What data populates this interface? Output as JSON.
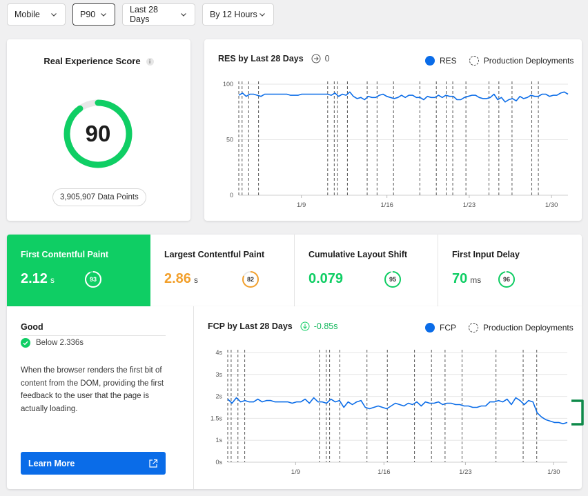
{
  "filters": [
    {
      "label": "Mobile"
    },
    {
      "label": "P90"
    },
    {
      "label": "Last 28 Days"
    },
    {
      "label": "By 12 Hours"
    }
  ],
  "score_card": {
    "title": "Real Experience Score",
    "info_icon": "i",
    "score": "90",
    "score_fraction": 0.9,
    "data_points": "3,905,907 Data Points",
    "colors": {
      "good": "#0fce64",
      "track": "#e8e8e8"
    }
  },
  "res_chart": {
    "title": "RES by Last 28 Days",
    "delta": "0",
    "legend_series": "RES",
    "legend_deploy": "Production Deployments"
  },
  "metrics": [
    {
      "name": "First Contentful Paint",
      "value": "2.12",
      "unit": "s",
      "score": "93",
      "score_fraction": 0.93,
      "color": "#ffffff",
      "selected": true
    },
    {
      "name": "Largest Contentful Paint",
      "value": "2.86",
      "unit": "s",
      "score": "82",
      "score_fraction": 0.82,
      "color": "#f2a02c",
      "selected": false
    },
    {
      "name": "Cumulative Layout Shift",
      "value": "0.079",
      "unit": "",
      "score": "95",
      "score_fraction": 0.95,
      "color": "#0fce64",
      "selected": false
    },
    {
      "name": "First Input Delay",
      "value": "70",
      "unit": "ms",
      "score": "96",
      "score_fraction": 0.96,
      "color": "#0fce64",
      "selected": false
    }
  ],
  "detail": {
    "rating": "Good",
    "threshold": "Below 2.336s",
    "description": "When the browser renders the first bit of content from the DOM, providing the first feedback to the user that the page is actually loading.",
    "learn_more": "Learn More"
  },
  "fcp_chart": {
    "title": "FCP by Last 28 Days",
    "delta": "-0.85s",
    "legend_series": "FCP",
    "legend_deploy": "Production Deployments"
  },
  "chart_data": [
    {
      "type": "line",
      "title": "RES by Last 28 Days",
      "x_tick_labels": [
        "1/9",
        "1/16",
        "1/23",
        "1/30"
      ],
      "y_tick_labels": [
        "0",
        "50",
        "100"
      ],
      "ylim": [
        0,
        100
      ],
      "grid": true,
      "legend": "top-right",
      "series": [
        {
          "name": "RES",
          "color": "#0a6ce8",
          "values": [
            90,
            92,
            89,
            91,
            91,
            90,
            89,
            91,
            91,
            91,
            91,
            91,
            91,
            91,
            90,
            90,
            90,
            91,
            91,
            91,
            91,
            91,
            91,
            91,
            91,
            90,
            92,
            89,
            91,
            90,
            93,
            89,
            87,
            88,
            86,
            89,
            88,
            88,
            90,
            91,
            89,
            88,
            87,
            88,
            90,
            88,
            90,
            90,
            88,
            88,
            86,
            89,
            88,
            88,
            90,
            88,
            90,
            89,
            89,
            86,
            86,
            88,
            89,
            90,
            90,
            88,
            87,
            87,
            88,
            91,
            86,
            88,
            84,
            86,
            87,
            85,
            89,
            87,
            88,
            90,
            89,
            89,
            91,
            91,
            89,
            90,
            90,
            92,
            93,
            91
          ]
        }
      ],
      "deployments_x_fraction": [
        0.0,
        0.01,
        0.03,
        0.06,
        0.27,
        0.29,
        0.3,
        0.33,
        0.39,
        0.42,
        0.47,
        0.55,
        0.6,
        0.63,
        0.65,
        0.69,
        0.76,
        0.79,
        0.83,
        0.89,
        0.91
      ]
    },
    {
      "type": "line",
      "title": "FCP by Last 28 Days",
      "x_tick_labels": [
        "1/9",
        "1/16",
        "1/23",
        "1/30"
      ],
      "y_tick_labels": [
        "0s",
        "1s",
        "1.5s",
        "2s",
        "3s",
        "4s"
      ],
      "ylim": [
        0,
        4
      ],
      "grid": true,
      "legend": "top-right",
      "series": [
        {
          "name": "FCP",
          "color": "#0a6ce8",
          "values": [
            2.3,
            2.15,
            2.35,
            2.2,
            2.25,
            2.2,
            2.2,
            2.3,
            2.2,
            2.25,
            2.25,
            2.2,
            2.2,
            2.2,
            2.2,
            2.15,
            2.2,
            2.2,
            2.3,
            2.15,
            2.35,
            2.2,
            2.2,
            2.15,
            2.3,
            2.2,
            2.25,
            2.0,
            2.2,
            2.1,
            2.2,
            2.25,
            2.0,
            1.95,
            2.0,
            2.05,
            2.0,
            1.95,
            2.05,
            2.15,
            2.1,
            2.05,
            2.15,
            2.1,
            2.2,
            2.05,
            2.2,
            2.15,
            2.15,
            2.2,
            2.1,
            2.15,
            2.15,
            2.1,
            2.1,
            2.05,
            2.05,
            2.0,
            2.0,
            2.05,
            2.05,
            2.2,
            2.2,
            2.25,
            2.2,
            2.3,
            2.1,
            2.35,
            2.25,
            2.1,
            2.25,
            2.2,
            1.8,
            1.65,
            1.55,
            1.5,
            1.45,
            1.45,
            1.4,
            1.45
          ]
        }
      ],
      "deployments_x_fraction": [
        0.0,
        0.01,
        0.03,
        0.05,
        0.27,
        0.29,
        0.3,
        0.33,
        0.41,
        0.47,
        0.55,
        0.6,
        0.64,
        0.69,
        0.79,
        0.87,
        0.91
      ]
    }
  ]
}
